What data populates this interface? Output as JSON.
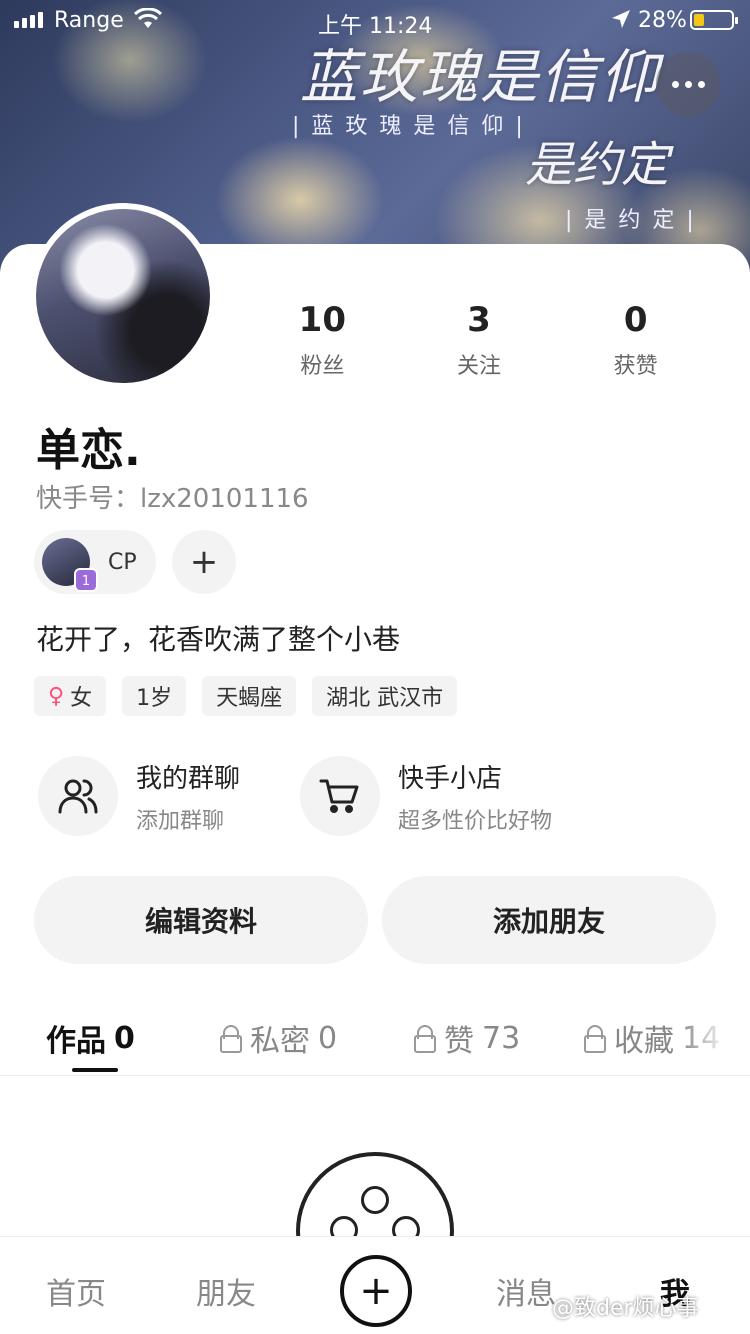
{
  "status_bar": {
    "carrier": "Range",
    "time": "上午 11:24",
    "battery_percent": "28%",
    "battery_level": 0.28
  },
  "banner": {
    "title_1": "蓝玫瑰是信仰",
    "subtitle_1": "|蓝玫瑰是信仰|",
    "title_2": "是约定",
    "subtitle_2": "|是约定|"
  },
  "profile": {
    "username": "单恋.",
    "user_id": "快手号：lzx20101116",
    "bio": "花开了，花香吹满了整个小巷",
    "cp_label": "CP",
    "cp_badge": "1",
    "add_symbol": "+"
  },
  "stats": [
    {
      "value": "10",
      "label": "粉丝"
    },
    {
      "value": "3",
      "label": "关注"
    },
    {
      "value": "0",
      "label": "获赞"
    }
  ],
  "tags": {
    "gender_icon": "♀",
    "gender": "女",
    "age": "1岁",
    "zodiac": "天蝎座",
    "location": "湖北 武汉市"
  },
  "features": {
    "group": {
      "title": "我的群聊",
      "subtitle": "添加群聊",
      "icon": "group-icon"
    },
    "shop": {
      "title": "快手小店",
      "subtitle": "超多性价比好物",
      "icon": "cart-icon"
    }
  },
  "actions": {
    "edit": "编辑资料",
    "add_friend": "添加朋友"
  },
  "tabs": {
    "works": {
      "label": "作品",
      "count": "0"
    },
    "private": {
      "label": "私密",
      "count": "0"
    },
    "likes": {
      "label": "赞",
      "count": "73"
    },
    "favorites": {
      "label": "收藏",
      "count": "14"
    }
  },
  "bottom_nav": {
    "home": "首页",
    "friends": "朋友",
    "plus": "+",
    "messages": "消息",
    "me": "我"
  },
  "watermark": "@致der烦心事"
}
